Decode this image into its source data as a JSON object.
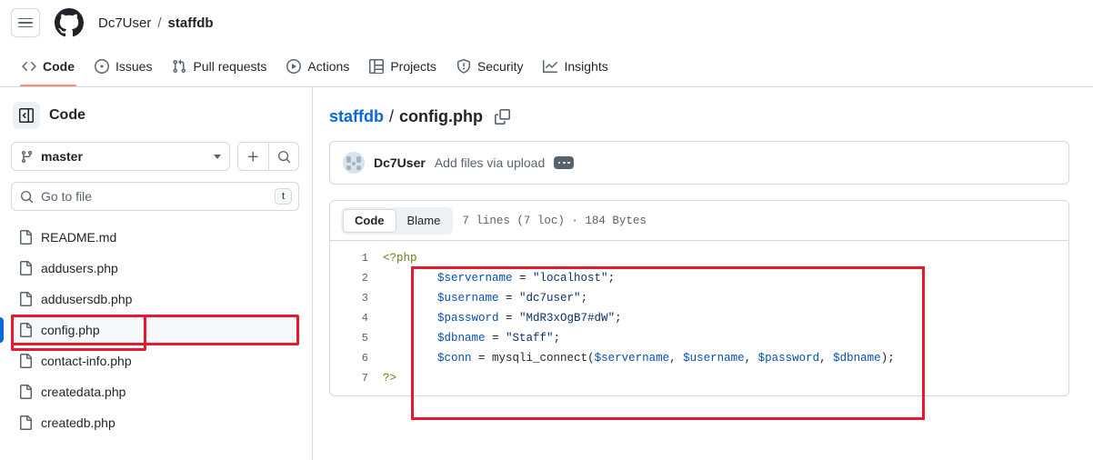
{
  "header": {
    "menu_icon": "hamburger-icon",
    "logo_icon": "github-logo-icon",
    "owner": "Dc7User",
    "separator": "/",
    "repo": "staffdb"
  },
  "repo_nav": {
    "items": [
      {
        "label": "Code",
        "icon": "code-icon",
        "active": true
      },
      {
        "label": "Issues",
        "icon": "issue-opened-icon",
        "active": false
      },
      {
        "label": "Pull requests",
        "icon": "git-pull-request-icon",
        "active": false
      },
      {
        "label": "Actions",
        "icon": "play-icon",
        "active": false
      },
      {
        "label": "Projects",
        "icon": "table-icon",
        "active": false
      },
      {
        "label": "Security",
        "icon": "shield-icon",
        "active": false
      },
      {
        "label": "Insights",
        "icon": "graph-icon",
        "active": false
      }
    ],
    "active_underline_color": "#fd8c73"
  },
  "sidebar": {
    "panel_icon": "side-panel-icon",
    "title": "Code",
    "branch": {
      "icon": "git-branch-icon",
      "name": "master",
      "caret_icon": "chevron-down-icon"
    },
    "add_button_icon": "plus-icon",
    "search_button_icon": "search-icon",
    "file_filter": {
      "icon": "search-icon",
      "placeholder": "Go to file",
      "shortcut": "t"
    },
    "files": [
      {
        "name": "README.md",
        "icon": "file-icon",
        "selected": false
      },
      {
        "name": "addusers.php",
        "icon": "file-icon",
        "selected": false
      },
      {
        "name": "addusersdb.php",
        "icon": "file-icon",
        "selected": false
      },
      {
        "name": "config.php",
        "icon": "file-icon",
        "selected": true
      },
      {
        "name": "contact-info.php",
        "icon": "file-icon",
        "selected": false
      },
      {
        "name": "createdata.php",
        "icon": "file-icon",
        "selected": false
      },
      {
        "name": "createdb.php",
        "icon": "file-icon",
        "selected": false
      }
    ],
    "selected_indicator_color": "#0969da"
  },
  "main": {
    "breadcrumb": {
      "repo": "staffdb",
      "separator": "/",
      "file": "config.php",
      "copy_icon": "copy-path-icon"
    },
    "commit": {
      "avatar_icon": "user-avatar",
      "author": "Dc7User",
      "message": "Add files via upload",
      "more_icon": "ellipsis-icon"
    },
    "code_toolbar": {
      "tabs": [
        {
          "label": "Code",
          "active": true
        },
        {
          "label": "Blame",
          "active": false
        }
      ],
      "file_meta": "7 lines (7 loc) · 184 Bytes"
    },
    "code": {
      "lines": [
        {
          "n": "1",
          "tokens": [
            {
              "t": "<?php",
              "c": "tok-php"
            }
          ]
        },
        {
          "n": "2",
          "tokens": [
            {
              "t": "        ",
              "c": "lc"
            },
            {
              "t": "$servername",
              "c": "tok-var"
            },
            {
              "t": " = ",
              "c": "lc"
            },
            {
              "t": "\"localhost\"",
              "c": "tok-str"
            },
            {
              "t": ";",
              "c": "lc"
            }
          ]
        },
        {
          "n": "3",
          "tokens": [
            {
              "t": "        ",
              "c": "lc"
            },
            {
              "t": "$username",
              "c": "tok-var"
            },
            {
              "t": " = ",
              "c": "lc"
            },
            {
              "t": "\"dc7user\"",
              "c": "tok-str"
            },
            {
              "t": ";",
              "c": "lc"
            }
          ]
        },
        {
          "n": "4",
          "tokens": [
            {
              "t": "        ",
              "c": "lc"
            },
            {
              "t": "$password",
              "c": "tok-var"
            },
            {
              "t": " = ",
              "c": "lc"
            },
            {
              "t": "\"MdR3xOgB7#dW\"",
              "c": "tok-str"
            },
            {
              "t": ";",
              "c": "lc"
            }
          ]
        },
        {
          "n": "5",
          "tokens": [
            {
              "t": "        ",
              "c": "lc"
            },
            {
              "t": "$dbname",
              "c": "tok-var"
            },
            {
              "t": " = ",
              "c": "lc"
            },
            {
              "t": "\"Staff\"",
              "c": "tok-str"
            },
            {
              "t": ";",
              "c": "lc"
            }
          ]
        },
        {
          "n": "6",
          "tokens": [
            {
              "t": "        ",
              "c": "lc"
            },
            {
              "t": "$conn",
              "c": "tok-var"
            },
            {
              "t": " = ",
              "c": "lc"
            },
            {
              "t": "mysqli_connect(",
              "c": "tok-fn"
            },
            {
              "t": "$servername",
              "c": "tok-var"
            },
            {
              "t": ", ",
              "c": "lc"
            },
            {
              "t": "$username",
              "c": "tok-var"
            },
            {
              "t": ", ",
              "c": "lc"
            },
            {
              "t": "$password",
              "c": "tok-var"
            },
            {
              "t": ", ",
              "c": "lc"
            },
            {
              "t": "$dbname",
              "c": "tok-var"
            },
            {
              "t": ");",
              "c": "lc"
            }
          ]
        },
        {
          "n": "7",
          "tokens": [
            {
              "t": "?>",
              "c": "tok-php"
            }
          ]
        }
      ]
    }
  },
  "annotations": {
    "code_box_color": "#e8192c",
    "file_box_color": "#e8192c"
  }
}
